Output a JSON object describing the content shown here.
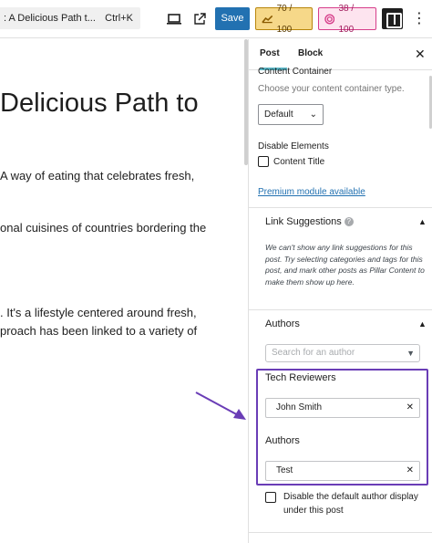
{
  "topbar": {
    "command_text": ": A Delicious Path t...",
    "command_shortcut": "Ctrl+K",
    "save_label": "Save",
    "seo_score": "70 / 100",
    "readability_score": "38 / 100"
  },
  "editor": {
    "title": "Delicious Path to",
    "paragraphs": [
      "A way of eating that celebrates fresh,",
      "onal cuisines of countries bordering the",
      ". It's a lifestyle centered around fresh,",
      "proach has been linked to a variety of"
    ]
  },
  "sidebar": {
    "tabs": [
      "Post",
      "Block"
    ],
    "clipped_heading": "",
    "content_container": {
      "label": "Content Container",
      "help": "Choose your content container type.",
      "selected": "Default"
    },
    "disable_elements": {
      "label": "Disable Elements",
      "option": "Content Title"
    },
    "premium_link": "Premium module available",
    "link_suggestions": {
      "heading": "Link Suggestions",
      "note": "We can't show any link suggestions for this post. Try selecting categories and tags for this post, and mark other posts as Pillar Content to make them show up here."
    },
    "authors_panel": {
      "heading": "Authors",
      "search_placeholder": "Search for an author",
      "tech_reviewers_label": "Tech Reviewers",
      "tech_reviewer_value": "John Smith",
      "authors_label": "Authors",
      "author_value": "Test",
      "disable_label": "Disable the default author display under this post"
    }
  },
  "colors": {
    "accent": "#2271b1",
    "highlight_box": "#6a3db6",
    "arrow": "#6a3db6",
    "seo_badge": "#f6d889",
    "readability_badge": "#fde4ef"
  }
}
